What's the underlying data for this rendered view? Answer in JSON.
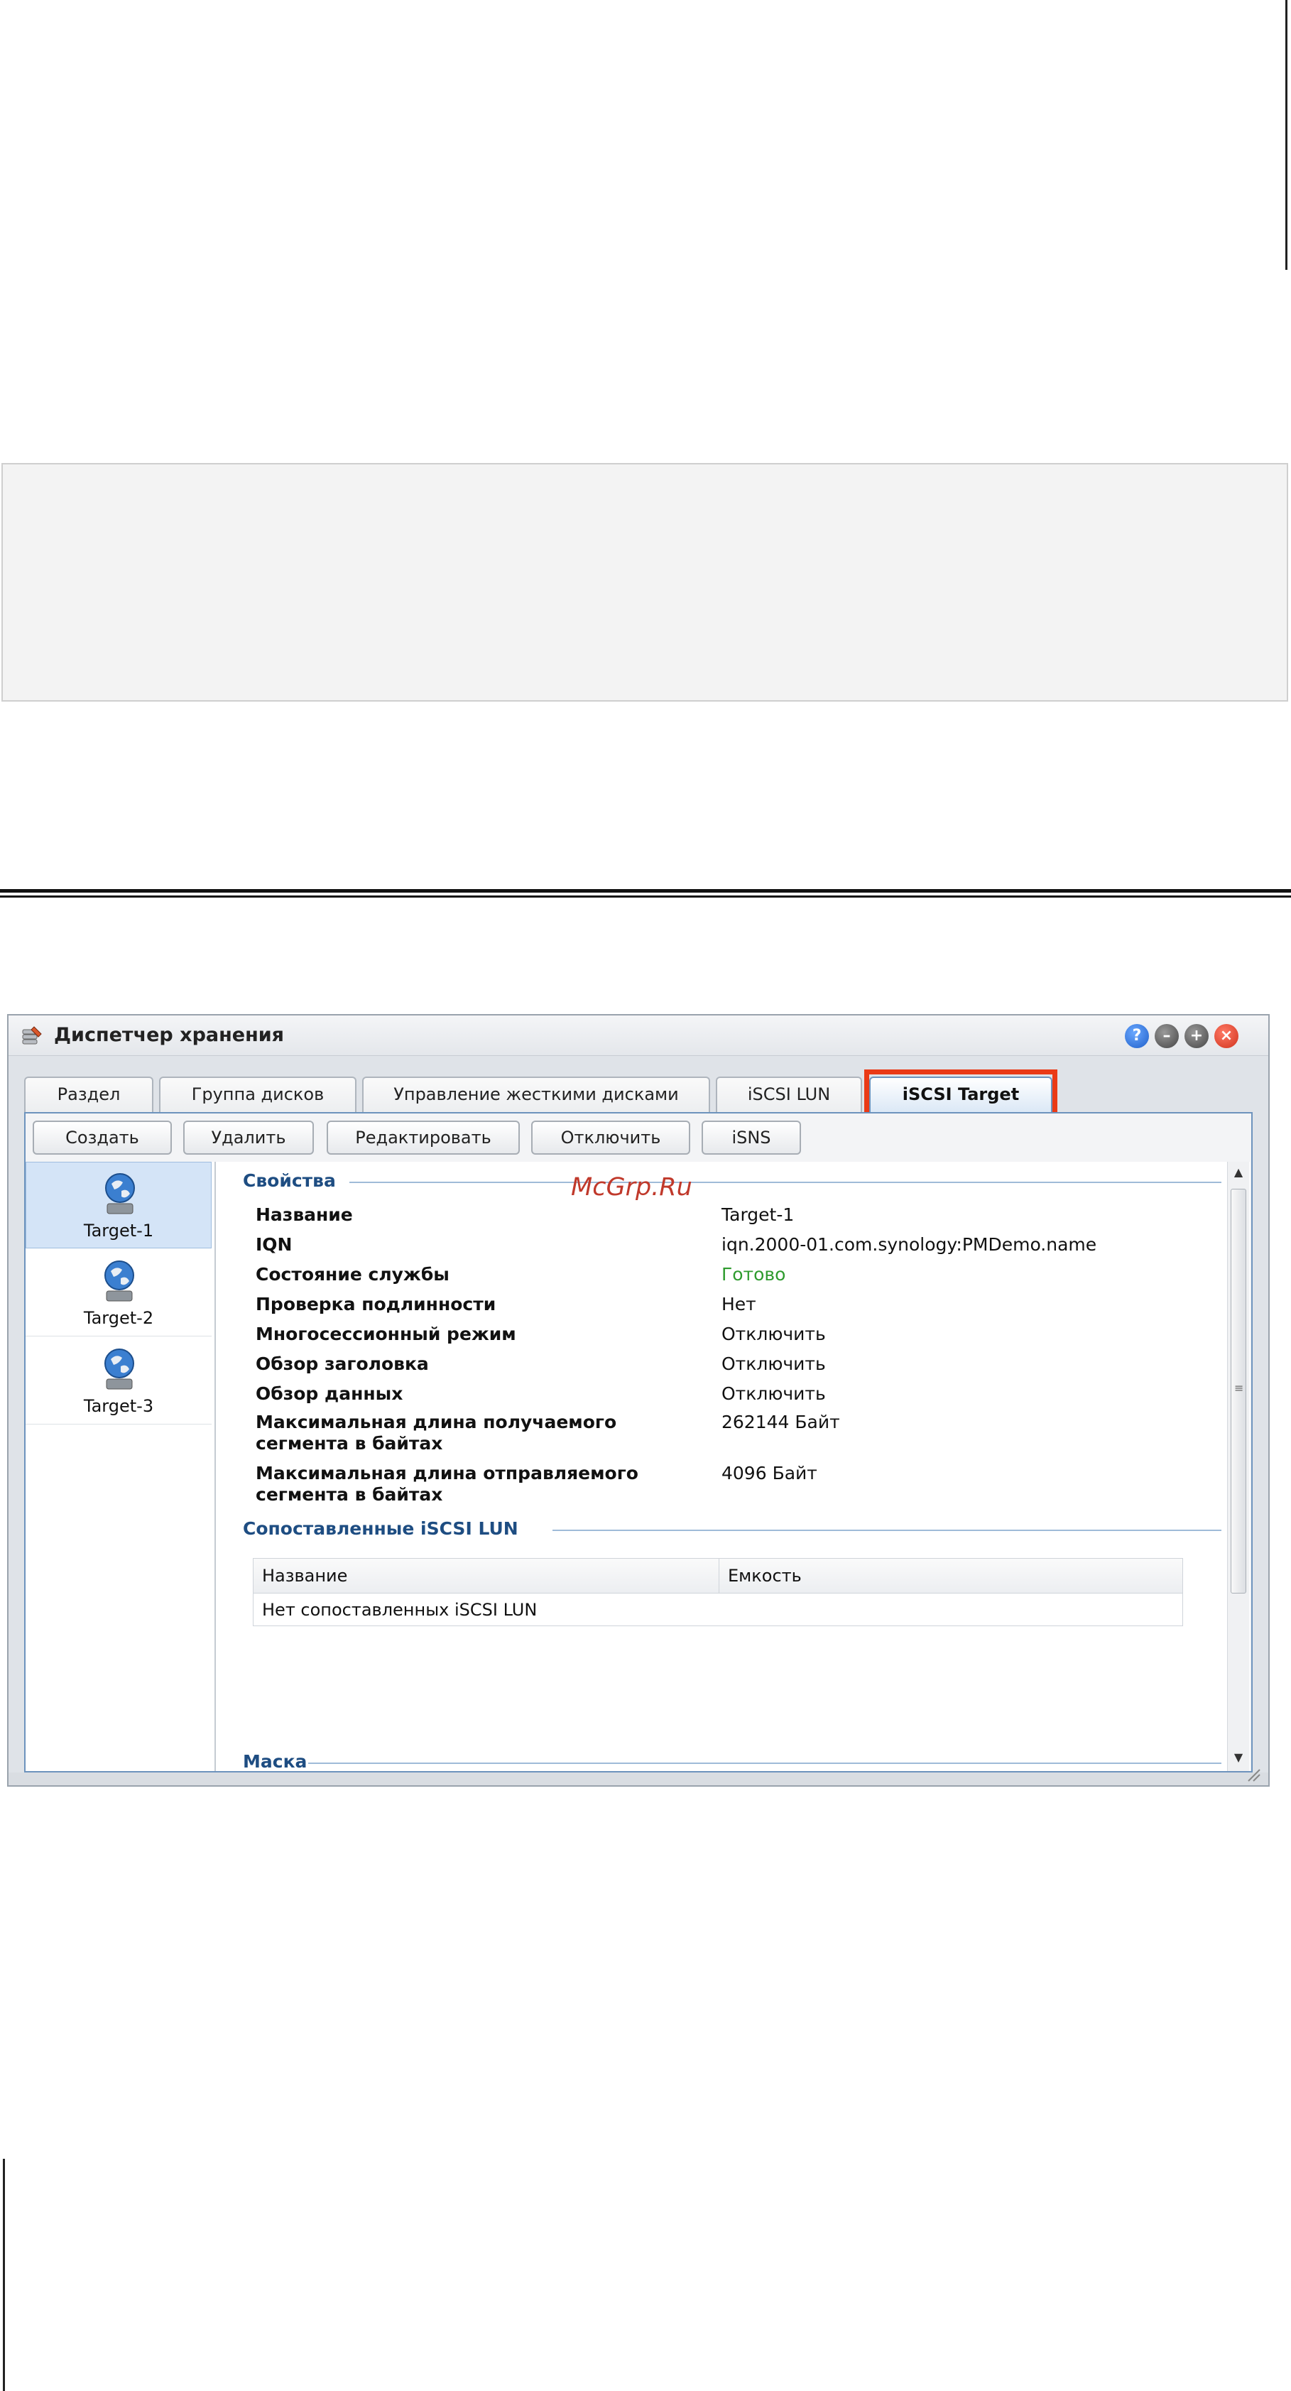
{
  "window": {
    "title": "Диспетчер хранения",
    "controls": [
      "help-icon",
      "minimize-icon",
      "maximize-icon",
      "close-icon"
    ]
  },
  "tabs": [
    {
      "label": "Раздел",
      "active": false
    },
    {
      "label": "Группа дисков",
      "active": false
    },
    {
      "label": "Управление жесткими дисками",
      "active": false
    },
    {
      "label": "iSCSI LUN",
      "active": false
    },
    {
      "label": "iSCSI Target",
      "active": true
    }
  ],
  "toolbar": {
    "create": "Создать",
    "delete": "Удалить",
    "edit": "Редактировать",
    "disable": "Отключить",
    "isns": "iSNS"
  },
  "targets": [
    {
      "label": "Target-1",
      "selected": true
    },
    {
      "label": "Target-2",
      "selected": false
    },
    {
      "label": "Target-3",
      "selected": false
    }
  ],
  "watermark": "McGrp.Ru",
  "properties": {
    "heading": "Свойства",
    "rows": [
      {
        "label": "Название",
        "value": "Target-1"
      },
      {
        "label": "IQN",
        "value": "iqn.2000-01.com.synology:PMDemo.name"
      },
      {
        "label": "Состояние службы",
        "value": "Готово"
      },
      {
        "label": "Проверка подлинности",
        "value": "Нет"
      },
      {
        "label": "Многосессионный режим",
        "value": "Отключить"
      },
      {
        "label": "Обзор заголовка",
        "value": "Отключить"
      },
      {
        "label": "Обзор данных",
        "value": "Отключить"
      },
      {
        "label": "Максимальная длина получаемого сегмента в байтах",
        "value": "262144 Байт"
      },
      {
        "label": "Максимальная длина отправляемого сегмента в байтах",
        "value": "4096 Байт"
      }
    ]
  },
  "mapped_luns": {
    "heading": "Сопоставленные iSCSI LUN",
    "columns": [
      "Название",
      "Емкость"
    ],
    "empty_text": "Нет сопоставленных iSCSI LUN"
  },
  "mask": {
    "heading": "Маска"
  },
  "colors": {
    "accent": "#1e4d82",
    "status_ok": "#2e9b2e",
    "highlight": "#ea3a16"
  }
}
